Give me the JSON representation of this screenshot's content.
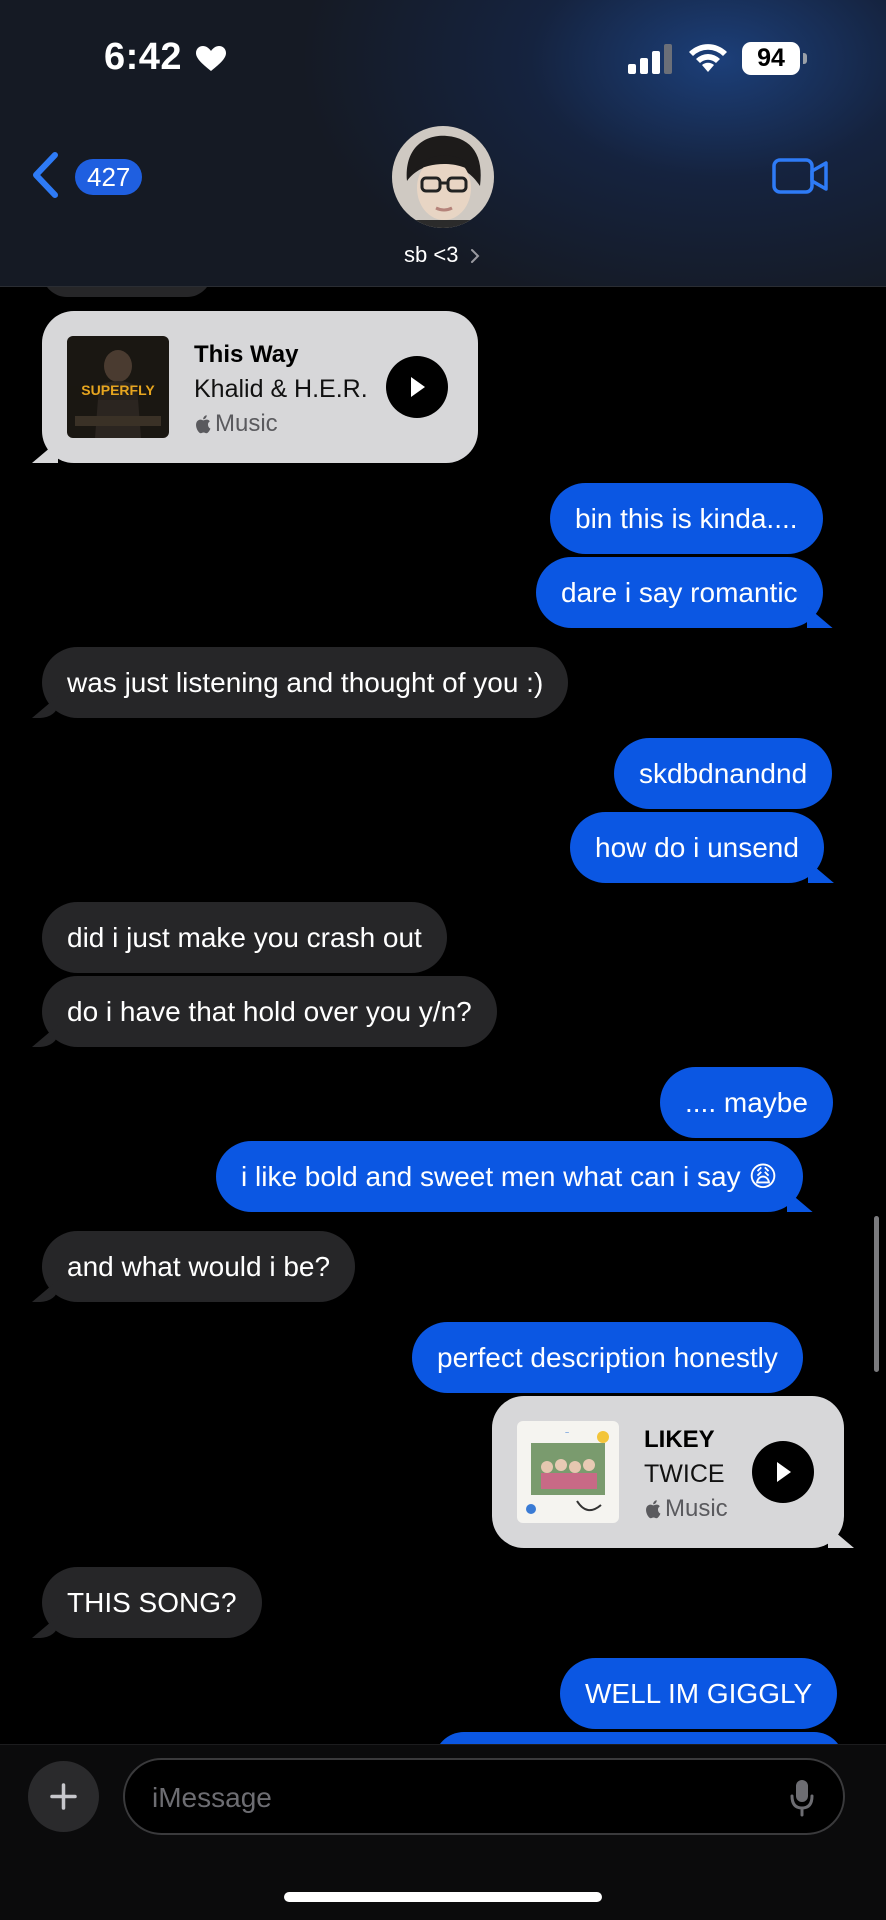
{
  "status_bar": {
    "time": "6:42",
    "battery": "94",
    "icons": [
      "heart-icon",
      "signal-icon",
      "wifi-icon",
      "battery-icon"
    ]
  },
  "header": {
    "back_count": "427",
    "contact_name": "sb <3",
    "icons": [
      "back-chevron-icon",
      "video-call-icon",
      "chevron-right-icon"
    ]
  },
  "messages": [
    {
      "kind": "music",
      "direction": "in",
      "title": "This Way",
      "artist": "Khalid & H.E.R.",
      "service": "Music",
      "album_text": "SUPERFLY"
    },
    {
      "kind": "text",
      "direction": "out",
      "text": "bin this is kinda...."
    },
    {
      "kind": "text",
      "direction": "out",
      "text": "dare i say romantic"
    },
    {
      "kind": "text",
      "direction": "in",
      "text": "was just listening and thought of you :)"
    },
    {
      "kind": "text",
      "direction": "out",
      "text": "skdbdnandnd"
    },
    {
      "kind": "text",
      "direction": "out",
      "text": "how do i unsend"
    },
    {
      "kind": "text",
      "direction": "in",
      "text": "did i just make you crash out"
    },
    {
      "kind": "text",
      "direction": "in",
      "text": "do i have that hold over you y/n?"
    },
    {
      "kind": "text",
      "direction": "out",
      "text": ".... maybe"
    },
    {
      "kind": "text",
      "direction": "out",
      "text": "i like bold and sweet men what can i say 😩"
    },
    {
      "kind": "text",
      "direction": "in",
      "text": "and what would i be?"
    },
    {
      "kind": "text",
      "direction": "out",
      "text": "perfect description honestly"
    },
    {
      "kind": "music",
      "direction": "out",
      "title": "LIKEY",
      "artist": "TWICE",
      "service": "Music"
    },
    {
      "kind": "text",
      "direction": "in",
      "text": "THIS SONG?"
    },
    {
      "kind": "text",
      "direction": "out",
      "text": "WELL IM GIGGLY"
    }
  ],
  "composer": {
    "placeholder": "iMessage",
    "icons": [
      "plus-icon",
      "microphone-icon"
    ]
  },
  "colors": {
    "outgoing_bubble": "#0b57e3",
    "incoming_bubble": "#262628",
    "music_card": "#d7d7d9",
    "accent": "#1f5fe0"
  }
}
